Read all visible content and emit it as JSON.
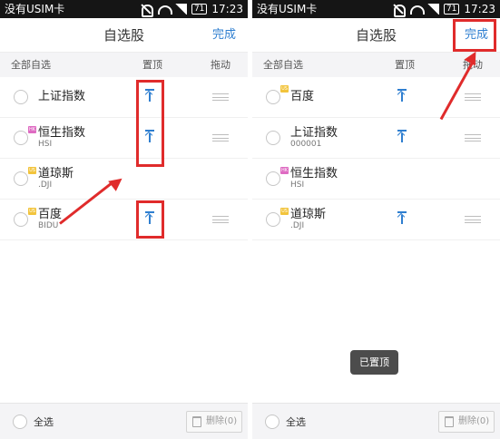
{
  "status_bar": {
    "carrier": "没有USIM卡",
    "battery": "71",
    "time": "17:23"
  },
  "header": {
    "title": "自选股",
    "done_label": "完成"
  },
  "columns": {
    "all_watch": "全部自选",
    "pin_top": "置顶",
    "drag": "拖动"
  },
  "left_rows": [
    {
      "name": "上证指数",
      "code": ""
    },
    {
      "name": "恒生指数",
      "code": "HSI",
      "tag": "HK"
    },
    {
      "name": "道琼斯",
      "code": ".DJI",
      "tag": "US"
    },
    {
      "name": "百度",
      "code": "BIDU",
      "tag": "US"
    }
  ],
  "right_rows": [
    {
      "name": "百度",
      "code": "",
      "tag": "US"
    },
    {
      "name": "上证指数",
      "code": "000001"
    },
    {
      "name": "恒生指数",
      "code": "HSI",
      "tag": "HK"
    },
    {
      "name": "道琼斯",
      "code": ".DJI",
      "tag": "US"
    }
  ],
  "bottom": {
    "select_all": "全选",
    "delete_label": "删除(0)"
  },
  "toast": {
    "text": "已置顶"
  },
  "colors": {
    "accent_blue": "#2f7fd0",
    "annotation_red": "#e02b2b"
  }
}
